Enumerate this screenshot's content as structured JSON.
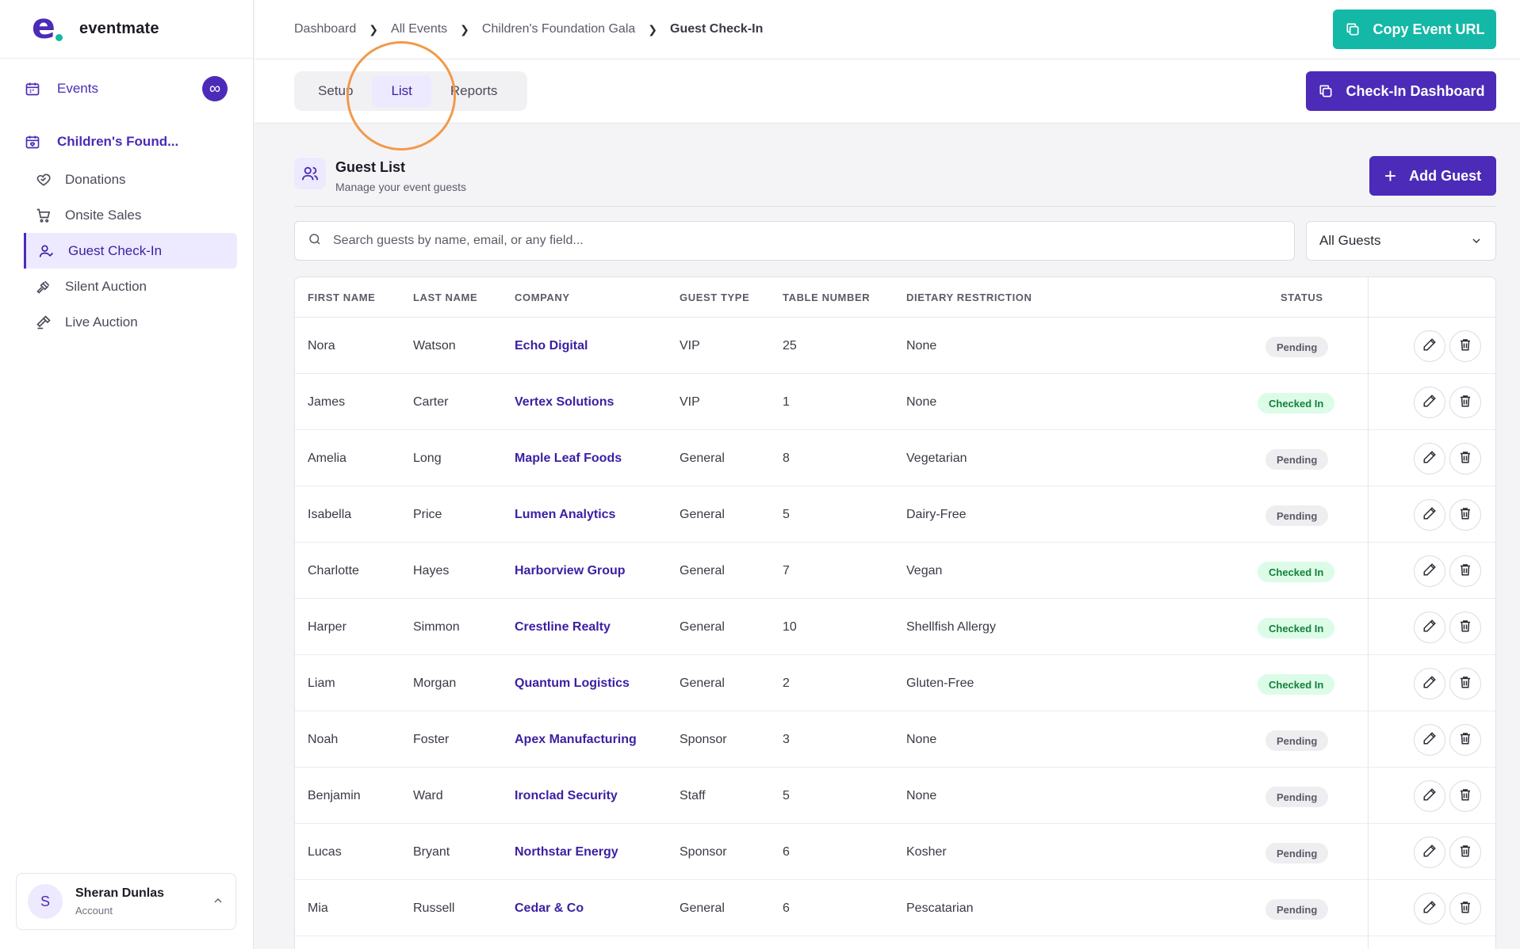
{
  "app": {
    "name": "eventmate",
    "logo_letter": "e"
  },
  "colors": {
    "brand": "#4b2bb8",
    "teal": "#14b8a6",
    "active_bg": "#ede9fe",
    "checked_text": "#15803d",
    "checked_bg": "#dcfce7",
    "highlight": "#f2994a"
  },
  "sidebar": {
    "events_label": "Events",
    "events_badge": "∞",
    "event_name": "Children's Found...",
    "items": [
      {
        "label": "Donations",
        "icon": "heart-handshake-icon"
      },
      {
        "label": "Onsite Sales",
        "icon": "shopping-cart-icon"
      },
      {
        "label": "Guest Check-In",
        "icon": "user-check-icon",
        "active": true
      },
      {
        "label": "Silent Auction",
        "icon": "gavel-icon"
      },
      {
        "label": "Live Auction",
        "icon": "hammer-icon"
      }
    ],
    "account": {
      "initial": "S",
      "name": "Sheran Dunlas",
      "sub": "Account"
    }
  },
  "breadcrumb": [
    "Dashboard",
    "All Events",
    "Children's Foundation Gala",
    "Guest Check-In"
  ],
  "topbar": {
    "copy_url_label": "Copy Event URL"
  },
  "tabs": {
    "items": [
      "Setup",
      "List",
      "Reports"
    ],
    "active": "List"
  },
  "checkin_dashboard_label": "Check-In Dashboard",
  "guest_list": {
    "title": "Guest List",
    "subtitle": "Manage your event guests",
    "add_label": "Add Guest",
    "search_placeholder": "Search guests by name, email, or any field...",
    "filter_value": "All Guests"
  },
  "table": {
    "columns": [
      "FIRST NAME",
      "LAST NAME",
      "COMPANY",
      "GUEST TYPE",
      "TABLE NUMBER",
      "DIETARY RESTRICTION",
      "STATUS"
    ],
    "rows": [
      [
        "Nora",
        "Watson",
        "Echo Digital",
        "VIP",
        "25",
        "None",
        "Pending"
      ],
      [
        "James",
        "Carter",
        "Vertex Solutions",
        "VIP",
        "1",
        "None",
        "Checked In"
      ],
      [
        "Amelia",
        "Long",
        "Maple Leaf Foods",
        "General",
        "8",
        "Vegetarian",
        "Pending"
      ],
      [
        "Isabella",
        "Price",
        "Lumen Analytics",
        "General",
        "5",
        "Dairy-Free",
        "Pending"
      ],
      [
        "Charlotte",
        "Hayes",
        "Harborview Group",
        "General",
        "7",
        "Vegan",
        "Checked In"
      ],
      [
        "Harper",
        "Simmon",
        "Crestline Realty",
        "General",
        "10",
        "Shellfish Allergy",
        "Checked In"
      ],
      [
        "Liam",
        "Morgan",
        "Quantum Logistics",
        "General",
        "2",
        "Gluten-Free",
        "Checked In"
      ],
      [
        "Noah",
        "Foster",
        "Apex Manufacturing",
        "Sponsor",
        "3",
        "None",
        "Pending"
      ],
      [
        "Benjamin",
        "Ward",
        "Ironclad Security",
        "Staff",
        "5",
        "None",
        "Pending"
      ],
      [
        "Lucas",
        "Bryant",
        "Northstar Energy",
        "Sponsor",
        "6",
        "Kosher",
        "Pending"
      ],
      [
        "Mia",
        "Russell",
        "Cedar & Co",
        "General",
        "6",
        "Pescatarian",
        "Pending"
      ]
    ]
  }
}
